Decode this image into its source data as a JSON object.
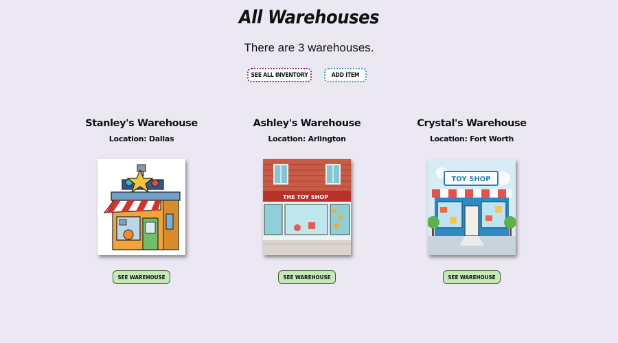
{
  "header": {
    "title": "All Warehouses",
    "count_text": "There are 3 warehouses."
  },
  "actions": {
    "see_all_inventory_label": "SEE ALL INVENTORY",
    "add_item_label": "ADD ITEM"
  },
  "warehouses": [
    {
      "name": "Stanley's Warehouse",
      "location": "Location: Dallas",
      "button_label": "SEE WAREHOUSE",
      "image_icon": "toy-shop-star-illustration"
    },
    {
      "name": "Ashley's Warehouse",
      "location": "Location: Arlington",
      "button_label": "SEE WAREHOUSE",
      "image_icon": "brick-toy-shop-illustration",
      "sign_text": "THE TOY SHOP"
    },
    {
      "name": "Crystal's Warehouse",
      "location": "Location: Fort Worth",
      "button_label": "SEE WAREHOUSE",
      "image_icon": "toy-shop-awning-illustration",
      "sign_text": "TOY SHOP"
    }
  ],
  "colors": {
    "background": "#ece8f3",
    "inventory_border": "#8a2a6e",
    "add_border": "#2b9bb5",
    "warehouse_button": "#c6e7b6"
  }
}
